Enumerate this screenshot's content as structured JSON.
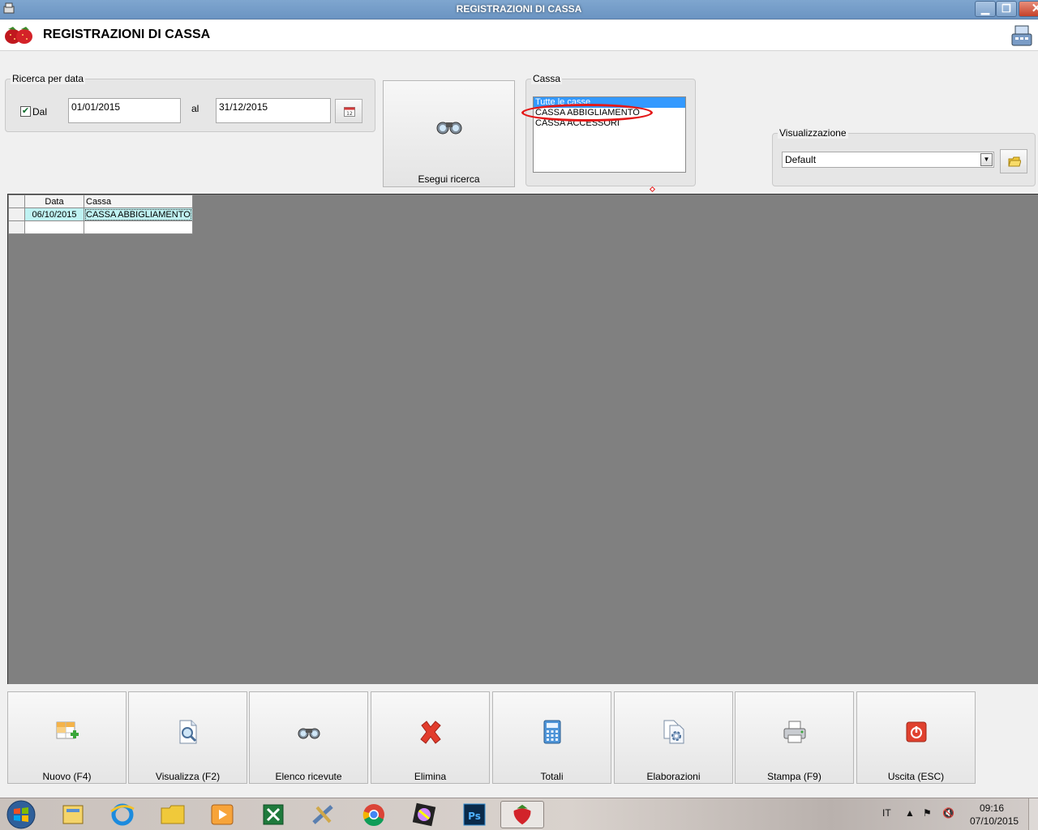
{
  "window": {
    "title": "REGISTRAZIONI DI CASSA",
    "minimize_label": "▁",
    "restore_label": "❐",
    "close_label": "✕"
  },
  "header": {
    "title": "REGISTRAZIONI DI CASSA"
  },
  "date_search": {
    "legend": "Ricerca per data",
    "from_checkbox_label": "Dal",
    "from_checked": true,
    "from_value": "01/01/2015",
    "to_label": "al",
    "to_value": "31/12/2015"
  },
  "search_button": {
    "label": "Esegui ricerca",
    "icon": "binoculars-icon"
  },
  "cassa": {
    "legend": "Cassa",
    "items": [
      "Tutte le casse",
      "CASSA ABBIGLIAMENTO",
      "CASSA ACCESSORI"
    ],
    "selected_index": 0
  },
  "view": {
    "legend": "Visualizzazione",
    "selected": "Default"
  },
  "grid": {
    "columns": [
      "Data",
      "Cassa"
    ],
    "rows": [
      [
        "06/10/2015",
        "CASSA ABBIGLIAMENTO"
      ],
      [
        "",
        ""
      ]
    ]
  },
  "actions": [
    {
      "label": "Nuovo (F4)",
      "icon": "add-table-icon"
    },
    {
      "label": "Visualizza (F2)",
      "icon": "view-document-icon"
    },
    {
      "label": "Elenco ricevute",
      "icon": "binoculars-icon"
    },
    {
      "label": "Elimina",
      "icon": "delete-x-icon"
    },
    {
      "label": "Totali",
      "icon": "calculator-icon"
    },
    {
      "label": "Elaborazioni",
      "icon": "process-document-icon"
    },
    {
      "label": "Stampa (F9)",
      "icon": "printer-icon"
    },
    {
      "label": "Uscita (ESC)",
      "icon": "power-icon"
    }
  ],
  "taskbar": {
    "language": "IT",
    "time": "09:16",
    "date": "07/10/2015",
    "apps": [
      "outlook-icon",
      "internet-explorer-icon",
      "file-explorer-icon",
      "media-player-icon",
      "excel-icon",
      "tools-icon",
      "chrome-icon",
      "color-app-icon",
      "photoshop-icon",
      "strawberry-app-icon"
    ]
  },
  "colors": {
    "accent_red": "#e41818",
    "selection_blue": "#3399ff",
    "grid_bg": "#808080"
  }
}
